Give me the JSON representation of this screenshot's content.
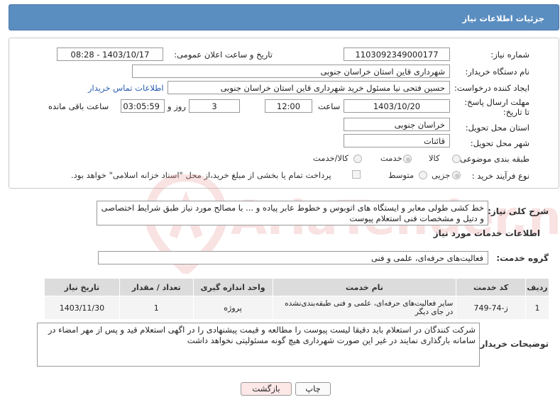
{
  "header": {
    "title": "جزئیات اطلاعات نیاز"
  },
  "form": {
    "need_number": {
      "label": "شماره نیاز:",
      "value": "1103092349000177"
    },
    "announce_datetime": {
      "label": "تاریخ و ساعت اعلان عمومی:",
      "value": "1403/10/17 - 08:28"
    },
    "buyer_org": {
      "label": "نام دستگاه خریدار:",
      "value": "شهرداری قاین استان خراسان جنوبی"
    },
    "requester": {
      "label": "ایجاد کننده درخواست:",
      "value": "حسین فتحی نیا مسئول خرید شهرداری قاین استان خراسان جنوبی",
      "contact_link": "اطلاعات تماس خریدار"
    },
    "deadline": {
      "label": "مهلت ارسال پاسخ: تا تاریخ:",
      "date": "1403/10/20",
      "time_label": "ساعت",
      "time": "12:00",
      "days": "3",
      "days_label": "روز و",
      "remaining": "03:05:59",
      "remaining_label": "ساعت باقی مانده"
    },
    "province": {
      "label": "استان محل تحویل:",
      "value": "خراسان جنوبی"
    },
    "city": {
      "label": "شهر محل تحویل:",
      "value": "قائنات"
    },
    "category": {
      "label": "طبقه بندی موضوعی:",
      "options": [
        "کالا",
        "خدمت",
        "کالا/خدمت"
      ],
      "selected": "خدمت"
    },
    "process": {
      "label": "نوع فرآیند خرید :",
      "options": [
        "جزیی",
        "متوسط"
      ],
      "selected": "جزیی",
      "note": "پرداخت تمام یا بخشی از مبلغ خرید،از محل \"اسناد خزانه اسلامی\" خواهد بود."
    }
  },
  "summary": {
    "label": "شرح کلی نیاز:",
    "value": "خط کشی طولی معابر و ایستگاه های اتوبوس و خطوط عابر پیاده و ... با مصالح مورد نیاز طبق شرایط اختصاصی و دتیل و مشخصات فنی استعلام پیوست"
  },
  "services": {
    "section_title": "اطلاعات خدمات مورد نیاز",
    "group_label": "گروه خدمت:",
    "group_value": "فعالیت‌های حرفه‌ای، علمی و فنی",
    "columns": [
      "ردیف",
      "کد خدمت",
      "نام خدمت",
      "واحد اندازه گیری",
      "تعداد / مقدار",
      "تاریخ نیاز"
    ],
    "rows": [
      [
        "1",
        "ز-74-749",
        "سایر فعالیت‌های حرفه‌ای، علمی و فنی طبقه‌بندی‌نشده در جای دیگر",
        "پروژه",
        "1",
        "1403/11/30"
      ]
    ]
  },
  "buyer_notes": {
    "label": "توضیحات خریدار:",
    "value": "شرکت کنندگان در استعلام باید دقیقا لیست پیوست را مطالعه و قیمت پیشنهادی را در اگهی استعلام قید و پس از مهر امضاء در سامانه بارگذاری نمایند در غیر این صورت شهرداری هیچ گونه مسئولیتی نخواهد داشت"
  },
  "buttons": {
    "print": "چاپ",
    "back": "بازگشت"
  },
  "watermark": {
    "text": "AriaTender.neT"
  },
  "colors": {
    "header_bg": "#5b8ec0",
    "link": "#2a5db0",
    "back_button_bg": "#fde7e7"
  }
}
